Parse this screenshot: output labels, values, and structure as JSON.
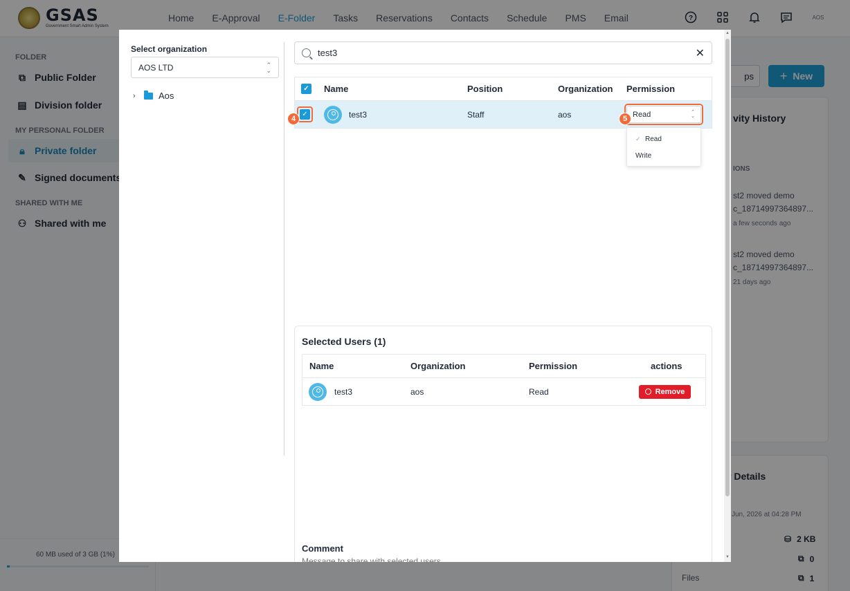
{
  "app": {
    "logo_title": "GSAS",
    "logo_subtitle": "Government Smart Admin System",
    "nav": [
      "Home",
      "E-Approval",
      "E-Folder",
      "Tasks",
      "Reservations",
      "Contacts",
      "Schedule",
      "PMS",
      "Email"
    ],
    "nav_active": "E-Folder",
    "user_badge": "AOS",
    "accent_color": "#1ea1d8"
  },
  "sidebar": {
    "section_folder": "FOLDER",
    "public_folder": "Public Folder",
    "division_folder": "Division folder",
    "section_personal": "MY PERSONAL FOLDER",
    "private_folder": "Private folder",
    "signed_documents": "Signed documents",
    "section_shared": "SHARED WITH ME",
    "shared_with_me": "Shared with me",
    "storage_text": "60 MB used of 3 GB (1%)",
    "storage_percent": 1
  },
  "background_right": {
    "ghost_button": "ps",
    "new_button": "New",
    "activity_title": "vity History",
    "activity_section": "IONS",
    "activities": [
      {
        "line1": "st2 moved demo",
        "line2": "c_18714997364897...",
        "time": "a few seconds ago"
      },
      {
        "line1": "st2 moved demo",
        "line2": "c_18714997364897...",
        "time": "21 days ago"
      }
    ],
    "details_title": "r Details",
    "details_date": "Jun, 2026 at 04:28 PM",
    "size_value": "2 KB",
    "folders_value": "0",
    "files_label": "Files",
    "files_value": "1"
  },
  "modal": {
    "org_label": "Select organization",
    "org_value": "AOS LTD",
    "tree_root": "Aos",
    "search_value": "test3",
    "user_table": {
      "headers": {
        "name": "Name",
        "position": "Position",
        "organization": "Organization",
        "permission": "Permission"
      },
      "rows": [
        {
          "name": "test3",
          "position": "Staff",
          "organization": "aos",
          "permission": "Read"
        }
      ]
    },
    "permission_options": [
      "Read",
      "Write"
    ],
    "step_badges": {
      "checkbox": "4",
      "permission": "5"
    },
    "selected_title": "Selected Users (1)",
    "selected_table": {
      "headers": {
        "name": "Name",
        "organization": "Organization",
        "permission": "Permission",
        "actions": "actions"
      },
      "rows": [
        {
          "name": "test3",
          "organization": "aos",
          "permission": "Read",
          "action": "Remove"
        }
      ]
    },
    "comment_label": "Comment",
    "comment_placeholder": "Message to share with selected users"
  }
}
